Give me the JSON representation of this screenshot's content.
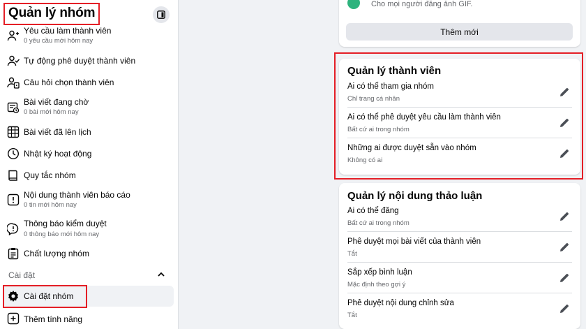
{
  "sidebar": {
    "title": "Quản lý nhóm",
    "items": [
      {
        "label": "Yêu cầu làm thành viên",
        "sub": "0 yêu cầu mới hôm nay",
        "icon": "person-add-icon"
      },
      {
        "label": "Tự động phê duyệt thành viên",
        "sub": "",
        "icon": "person-check-icon"
      },
      {
        "label": "Câu hỏi chọn thành viên",
        "sub": "",
        "icon": "person-question-icon"
      },
      {
        "label": "Bài viết đang chờ",
        "sub": "0 bài mới hôm nay",
        "icon": "pending-post-icon"
      },
      {
        "label": "Bài viết đã lên lịch",
        "sub": "",
        "icon": "calendar-grid-icon"
      },
      {
        "label": "Nhật ký hoạt động",
        "sub": "",
        "icon": "clock-icon"
      },
      {
        "label": "Quy tắc nhóm",
        "sub": "",
        "icon": "rules-book-icon"
      },
      {
        "label": "Nội dung thành viên báo cáo",
        "sub": "0 tin mới hôm nay",
        "icon": "report-icon"
      },
      {
        "label": "Thông báo kiểm duyệt",
        "sub": "0 thông báo mới hôm nay",
        "icon": "moderation-alert-icon"
      },
      {
        "label": "Chất lượng nhóm",
        "sub": "",
        "icon": "group-quality-icon"
      }
    ],
    "settings_section": "Cài đặt",
    "settings_items": [
      {
        "label": "Cài đặt nhóm",
        "icon": "gear-icon"
      },
      {
        "label": "Thêm tính năng",
        "icon": "add-feature-icon"
      }
    ]
  },
  "top_card": {
    "gif_text": "Cho mọi người đăng ảnh GIF.",
    "add_button": "Thêm mới"
  },
  "members_card": {
    "title": "Quản lý thành viên",
    "rows": [
      {
        "label": "Ai có thể tham gia nhóm",
        "value": "Chỉ trang cá nhân"
      },
      {
        "label": "Ai có thể phê duyệt yêu cầu làm thành viên",
        "value": "Bất cứ ai trong nhóm"
      },
      {
        "label": "Những ai được duyệt sẵn vào nhóm",
        "value": "Không có ai"
      }
    ]
  },
  "content_card": {
    "title": "Quản lý nội dung thảo luận",
    "rows": [
      {
        "label": "Ai có thể đăng",
        "value": "Bất cứ ai trong nhóm"
      },
      {
        "label": "Phê duyệt mọi bài viết của thành viên",
        "value": "Tắt"
      },
      {
        "label": "Sắp xếp bình luận",
        "value": "Mặc định theo gợi ý"
      },
      {
        "label": "Phê duyệt nội dung chỉnh sửa",
        "value": "Tắt"
      }
    ]
  },
  "colors": {
    "highlight_border": "#e41e26",
    "text_primary": "#050505",
    "text_secondary": "#65676b",
    "page_bg": "#f0f2f5"
  }
}
